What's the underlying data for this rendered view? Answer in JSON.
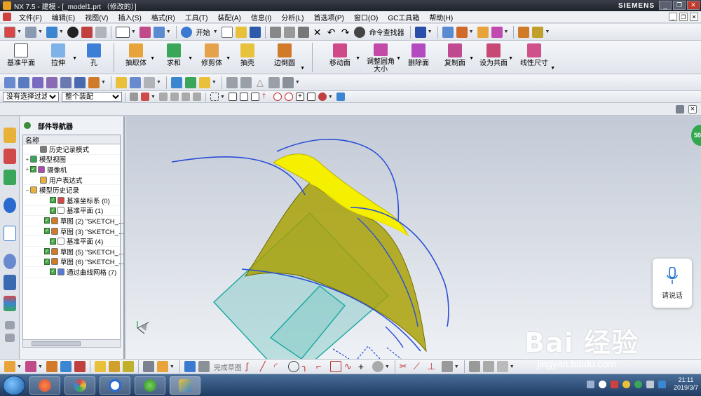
{
  "window": {
    "title": "NX 7.5 - 建模 - [_model1.prt （修改的）]",
    "brand": "SIEMENS",
    "buttons": [
      "_",
      "❐",
      "✕"
    ]
  },
  "menubar": {
    "items": [
      "文件(F)",
      "编辑(E)",
      "视图(V)",
      "插入(S)",
      "格式(R)",
      "工具(T)",
      "装配(A)",
      "信息(I)",
      "分析(L)",
      "首选项(P)",
      "窗口(O)",
      "GC工具箱",
      "帮助(H)"
    ],
    "doc_buttons": [
      "_",
      "❐",
      "✕"
    ]
  },
  "toolbar1": {
    "start_label": "开始",
    "command_finder_label": "命令查找器"
  },
  "feature_toolbar": {
    "left": [
      {
        "label": "基准平面",
        "icon": "datum-plane-icon",
        "color": "#ffffff"
      },
      {
        "label": "拉伸",
        "icon": "extrude-icon",
        "color": "#7fb2e6"
      },
      {
        "label": "孔",
        "icon": "hole-icon",
        "color": "#3d7fd6"
      },
      {
        "label": "抽取体",
        "icon": "extract-body-icon",
        "color": "#e8a43a"
      },
      {
        "label": "求和",
        "icon": "unite-icon",
        "color": "#3aa65a"
      },
      {
        "label": "修剪体",
        "icon": "trim-body-icon",
        "color": "#e6a24a"
      },
      {
        "label": "抽壳",
        "icon": "shell-icon",
        "color": "#e8c23a"
      },
      {
        "label": "边倒圆",
        "icon": "edge-blend-icon",
        "color": "#d07a2a"
      }
    ],
    "right": [
      {
        "label": "移动面",
        "icon": "move-face-icon",
        "color": "#d04a8a"
      },
      {
        "label": "调整圆角大小",
        "icon": "resize-blend-icon",
        "color": "#c44aa8"
      },
      {
        "label": "删除面",
        "icon": "delete-face-icon",
        "color": "#b44ac0"
      },
      {
        "label": "复制面",
        "icon": "copy-face-icon",
        "color": "#c04a90"
      },
      {
        "label": "设为共面",
        "icon": "make-coplanar-icon",
        "color": "#c84a74"
      },
      {
        "label": "线性尺寸",
        "icon": "linear-dimension-icon",
        "color": "#d0508c"
      }
    ]
  },
  "selection_bar": {
    "filter_value": "没有选择过滤器",
    "scope_value": "整个装配"
  },
  "navigator": {
    "title": "部件导航器",
    "column_header": "名称",
    "rows": [
      {
        "label": "历史记录模式",
        "indent": 1,
        "expand": "",
        "check": false,
        "icon_color": "#7a7a7a"
      },
      {
        "label": "模型视图",
        "indent": 0,
        "expand": "+",
        "check": false,
        "icon_color": "#3aa65a"
      },
      {
        "label": "摄像机",
        "indent": 0,
        "expand": "+",
        "check": true,
        "icon_color": "#b04ab0"
      },
      {
        "label": "用户表达式",
        "indent": 1,
        "expand": "",
        "check": false,
        "icon_color": "#e8b23a"
      },
      {
        "label": "模型历史记录",
        "indent": 0,
        "expand": "−",
        "check": false,
        "icon_color": "#e8b23a"
      },
      {
        "label": "基准坐标系 (0)",
        "indent": 2,
        "expand": "",
        "check": true,
        "icon_color": "#d04a4a"
      },
      {
        "label": "基准平面 (1)",
        "indent": 2,
        "expand": "",
        "check": true,
        "icon_color": "#ffffff"
      },
      {
        "label": "草图 (2) \"SKETCH_...",
        "indent": 2,
        "expand": "",
        "check": true,
        "icon_color": "#d07a2a"
      },
      {
        "label": "草图 (3) \"SKETCH_...",
        "indent": 2,
        "expand": "",
        "check": true,
        "icon_color": "#d07a2a"
      },
      {
        "label": "基准平面 (4)",
        "indent": 2,
        "expand": "",
        "check": true,
        "icon_color": "#ffffff"
      },
      {
        "label": "草图 (5) \"SKETCH_...",
        "indent": 2,
        "expand": "",
        "check": true,
        "icon_color": "#d07a2a"
      },
      {
        "label": "草图 (6) \"SKETCH_...",
        "indent": 2,
        "expand": "",
        "check": true,
        "icon_color": "#d07a2a"
      },
      {
        "label": "通过曲线网格 (7)",
        "indent": 2,
        "expand": "",
        "check": true,
        "icon_color": "#5a7ad0"
      }
    ]
  },
  "bottom_toolbar": {
    "finish_sketch_label": "完成草图"
  },
  "voice_widget": {
    "label": "请说话"
  },
  "badge": {
    "value": "50"
  },
  "watermark": {
    "main": "Bai 经验",
    "url": "jingyan.baidu.com"
  },
  "taskbar": {
    "time": "21:11",
    "date": "2019/3/7"
  },
  "colors": {
    "surface_yellow": "#f5f000",
    "surface_olive": "#a8a000",
    "plane_cyan": "#7cc8c4",
    "curve_blue": "#2a4fd6",
    "accent_green": "#2fa84f"
  }
}
